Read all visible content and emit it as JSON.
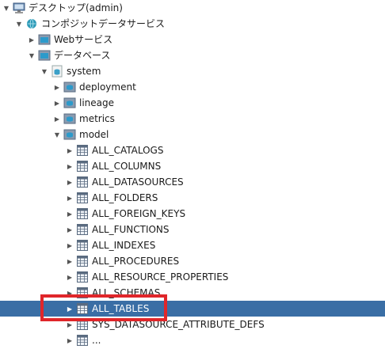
{
  "tree": [
    {
      "label": "デスクトップ(admin)",
      "icon": "desktop-icon",
      "expanded": true,
      "depth": 0
    },
    {
      "label": "コンポジットデータサービス",
      "icon": "globe-icon",
      "expanded": true,
      "depth": 1
    },
    {
      "label": "Webサービス",
      "icon": "folder-icon",
      "expanded": false,
      "depth": 2
    },
    {
      "label": "データベース",
      "icon": "folder-icon",
      "expanded": true,
      "depth": 2
    },
    {
      "label": "system",
      "icon": "database-icon",
      "expanded": true,
      "depth": 3
    },
    {
      "label": "deployment",
      "icon": "schema-folder-icon",
      "expanded": false,
      "depth": 4
    },
    {
      "label": "lineage",
      "icon": "schema-folder-icon",
      "expanded": false,
      "depth": 4
    },
    {
      "label": "metrics",
      "icon": "schema-folder-icon",
      "expanded": false,
      "depth": 4
    },
    {
      "label": "model",
      "icon": "schema-folder-icon",
      "expanded": true,
      "depth": 4
    },
    {
      "label": "ALL_CATALOGS",
      "icon": "table-icon",
      "expanded": false,
      "depth": 5
    },
    {
      "label": "ALL_COLUMNS",
      "icon": "table-icon",
      "expanded": false,
      "depth": 5
    },
    {
      "label": "ALL_DATASOURCES",
      "icon": "table-icon",
      "expanded": false,
      "depth": 5
    },
    {
      "label": "ALL_FOLDERS",
      "icon": "table-icon",
      "expanded": false,
      "depth": 5
    },
    {
      "label": "ALL_FOREIGN_KEYS",
      "icon": "table-icon",
      "expanded": false,
      "depth": 5
    },
    {
      "label": "ALL_FUNCTIONS",
      "icon": "table-icon",
      "expanded": false,
      "depth": 5
    },
    {
      "label": "ALL_INDEXES",
      "icon": "table-icon",
      "expanded": false,
      "depth": 5
    },
    {
      "label": "ALL_PROCEDURES",
      "icon": "table-icon",
      "expanded": false,
      "depth": 5
    },
    {
      "label": "ALL_RESOURCE_PROPERTIES",
      "icon": "table-icon",
      "expanded": false,
      "depth": 5
    },
    {
      "label": "ALL_SCHEMAS",
      "icon": "table-icon",
      "expanded": false,
      "depth": 5
    },
    {
      "label": "ALL_TABLES",
      "icon": "table-icon",
      "expanded": false,
      "depth": 5,
      "selected": true
    },
    {
      "label": "SYS_DATASOURCE_ATTRIBUTE_DEFS",
      "icon": "table-icon",
      "expanded": false,
      "depth": 5
    },
    {
      "label": "...",
      "icon": "table-icon",
      "expanded": false,
      "depth": 5
    }
  ],
  "colors": {
    "selection": "#3a6ea5",
    "highlight_box": "#e0262a"
  }
}
